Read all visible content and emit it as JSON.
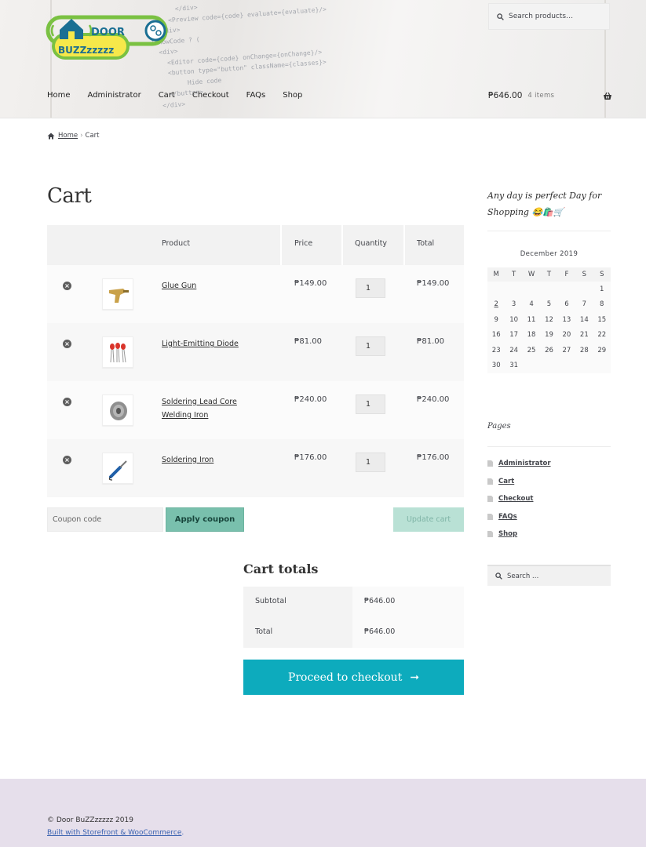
{
  "site": {
    "logo_line1": "DOOR",
    "logo_line2": "BUZZzzzzz"
  },
  "colors": {
    "accent_checkout": "#0dabbd",
    "apply_coupon": "#79c0ad",
    "update_cart_disabled": "#b9e1d5",
    "footer_bg": "#e6dfeb",
    "logo_green": "#7ac142",
    "logo_teal": "#1a6f93"
  },
  "header": {
    "search_placeholder": "Search products…",
    "nav": [
      "Home",
      "Administrator",
      "Cart",
      "Checkout",
      "FAQs",
      "Shop"
    ],
    "mini_cart_amount": "₱646.00",
    "mini_cart_count": "4 items",
    "icons": [
      "search-icon",
      "basket-icon"
    ]
  },
  "breadcrumb": {
    "home": "Home",
    "separator": "›",
    "current": "Cart"
  },
  "page": {
    "title": "Cart"
  },
  "cart": {
    "headers": {
      "product": "Product",
      "price": "Price",
      "quantity": "Quantity",
      "total": "Total"
    },
    "items": [
      {
        "name": "Glue Gun",
        "price": "₱149.00",
        "qty": "1",
        "total": "₱149.00"
      },
      {
        "name": "Light-Emitting Diode",
        "price": "₱81.00",
        "qty": "1",
        "total": "₱81.00"
      },
      {
        "name": "Soldering Lead Core Welding Iron",
        "price": "₱240.00",
        "qty": "1",
        "total": "₱240.00"
      },
      {
        "name": "Soldering Iron",
        "price": "₱176.00",
        "qty": "1",
        "total": "₱176.00"
      }
    ],
    "coupon_placeholder": "Coupon code",
    "apply_coupon": "Apply coupon",
    "update_cart": "Update cart"
  },
  "totals": {
    "title": "Cart totals",
    "subtotal_label": "Subtotal",
    "subtotal_value": "₱646.00",
    "total_label": "Total",
    "total_value": "₱646.00",
    "checkout": "Proceed to checkout",
    "checkout_arrow": "➞"
  },
  "sidebar": {
    "tagline": "Any day is perfect Day for Shopping 😂🛍️🛒",
    "calendar": {
      "caption": "December 2019",
      "days": [
        "M",
        "T",
        "W",
        "T",
        "F",
        "S",
        "S"
      ],
      "weeks": [
        [
          "",
          "",
          "",
          "",
          "",
          "",
          "1"
        ],
        [
          "2",
          "3",
          "4",
          "5",
          "6",
          "7",
          "8"
        ],
        [
          "9",
          "10",
          "11",
          "12",
          "13",
          "14",
          "15"
        ],
        [
          "16",
          "17",
          "18",
          "19",
          "20",
          "21",
          "22"
        ],
        [
          "23",
          "24",
          "25",
          "26",
          "27",
          "28",
          "29"
        ],
        [
          "30",
          "31",
          "",
          "",
          "",
          "",
          ""
        ]
      ],
      "linked_day": "2"
    },
    "pages_title": "Pages",
    "pages": [
      "Administrator",
      "Cart",
      "Checkout",
      "FAQs",
      "Shop"
    ],
    "search_placeholder": "Search …"
  },
  "footer": {
    "copyright": "© Door BuZZzzzzz 2019",
    "built_with": "Built with Storefront & WooCommerce",
    "built_suffix": "."
  }
}
